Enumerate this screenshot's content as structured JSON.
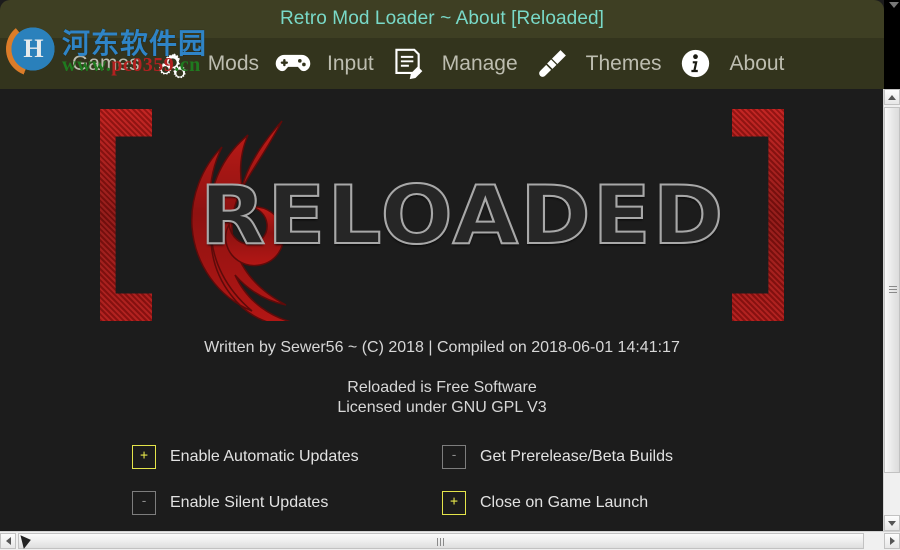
{
  "window": {
    "title": "Retro Mod Loader ~ About [Reloaded]",
    "title_color": "#79d9c8",
    "titlebar_bg": "#3e3f23",
    "navbar_bg": "#33341d",
    "content_bg": "#1c1c1c"
  },
  "nav": {
    "items": [
      {
        "label": "Games",
        "icon": "gears-icon"
      },
      {
        "label": "Mods",
        "icon": "gamepad-icon"
      },
      {
        "label": "Input",
        "icon": "list-edit-icon"
      },
      {
        "label": "Manage",
        "icon": "paintbrush-icon"
      },
      {
        "label": "Themes",
        "icon": "info-circle-icon"
      },
      {
        "label": "About",
        "icon": ""
      }
    ]
  },
  "watermark": {
    "site_cn": "河东软件园",
    "url_prefix": "www.",
    "url_highlight": "pc0359",
    "url_suffix": ".cn",
    "logo_letter": "H",
    "color_cn": "#2f84c6",
    "color_url": "#1f7a1f",
    "color_url_highlight": "#b32020"
  },
  "logo": {
    "wordmark": "RELOADED",
    "bracket_left": "[",
    "bracket_right": "]",
    "red": "#a81513",
    "metal": "#a8a8a8"
  },
  "about": {
    "line1": "Written by Sewer56 ~ (C) 2018 | Compiled on 2018-06-01 14:41:17",
    "line2": "Reloaded is Free Software",
    "line3": "Licensed under GNU GPL V3"
  },
  "options": {
    "checked_glyph": "+",
    "unchecked_glyph": "-",
    "checked_color": "#e4e44a",
    "unchecked_color": "#8d8d8d",
    "items": [
      {
        "label": "Enable Automatic Updates",
        "checked": true
      },
      {
        "label": "Get Prerelease/Beta Builds",
        "checked": false
      },
      {
        "label": "Enable Silent Updates",
        "checked": false
      },
      {
        "label": "Close on Game Launch",
        "checked": true
      }
    ]
  },
  "scrollbars": {
    "vertical": {
      "up_icon": "scroll-up-arrow",
      "down_icon": "scroll-down-arrow"
    },
    "horizontal": {
      "left_icon": "scroll-left-arrow",
      "right_icon": "scroll-right-arrow"
    }
  }
}
